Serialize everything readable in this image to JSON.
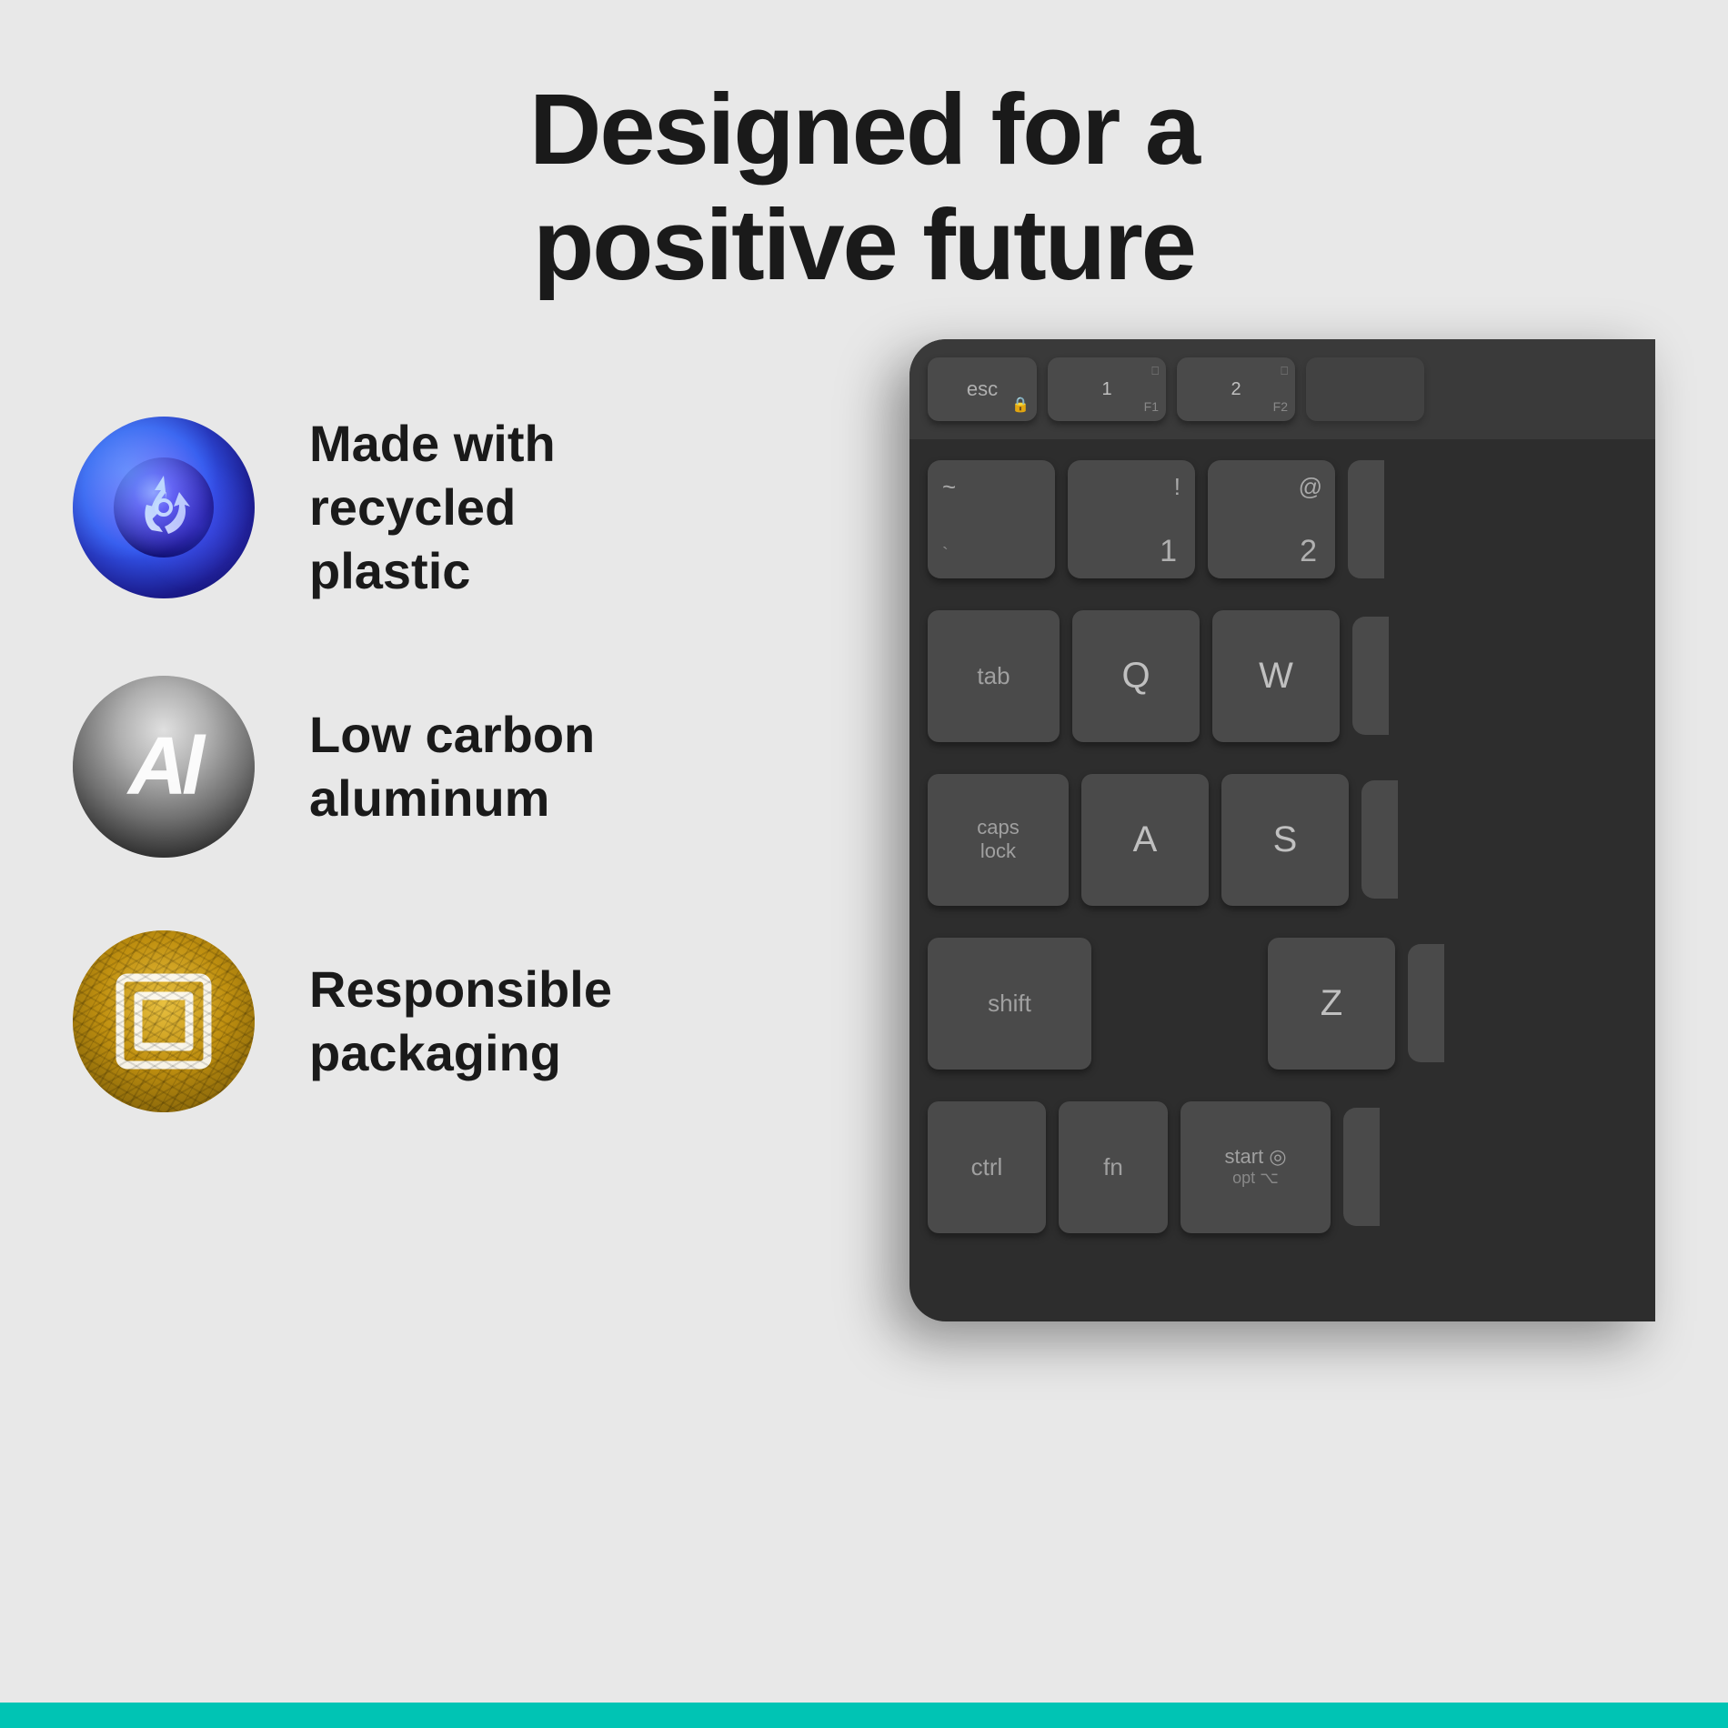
{
  "page": {
    "background_color": "#e8e8e8",
    "bottom_bar_color": "#00c4b4"
  },
  "title": {
    "line1": "Designed for a",
    "line2": "positive future"
  },
  "features": [
    {
      "id": "recycled-plastic",
      "icon_type": "recycled",
      "label_line1": "Made with",
      "label_line2": "recycled plastic"
    },
    {
      "id": "low-carbon-aluminum",
      "icon_type": "aluminum",
      "label_line1": "Low carbon",
      "label_line2": "aluminum"
    },
    {
      "id": "responsible-packaging",
      "icon_type": "packaging",
      "label_line1": "Responsible",
      "label_line2": "packaging"
    }
  ],
  "keyboard": {
    "visible": true,
    "keys": {
      "esc": "esc",
      "fn1": "1",
      "fn2": "2",
      "tilde": "~",
      "backtick": "`",
      "exclaim": "!",
      "num1": "1",
      "at": "@",
      "num2": "2",
      "tab": "tab",
      "q": "Q",
      "w": "W",
      "caps_lock": "caps lock",
      "a": "A",
      "s": "S",
      "shift": "shift",
      "z": "Z",
      "ctrl": "ctrl",
      "fn": "fn",
      "start_opt": "start"
    }
  }
}
